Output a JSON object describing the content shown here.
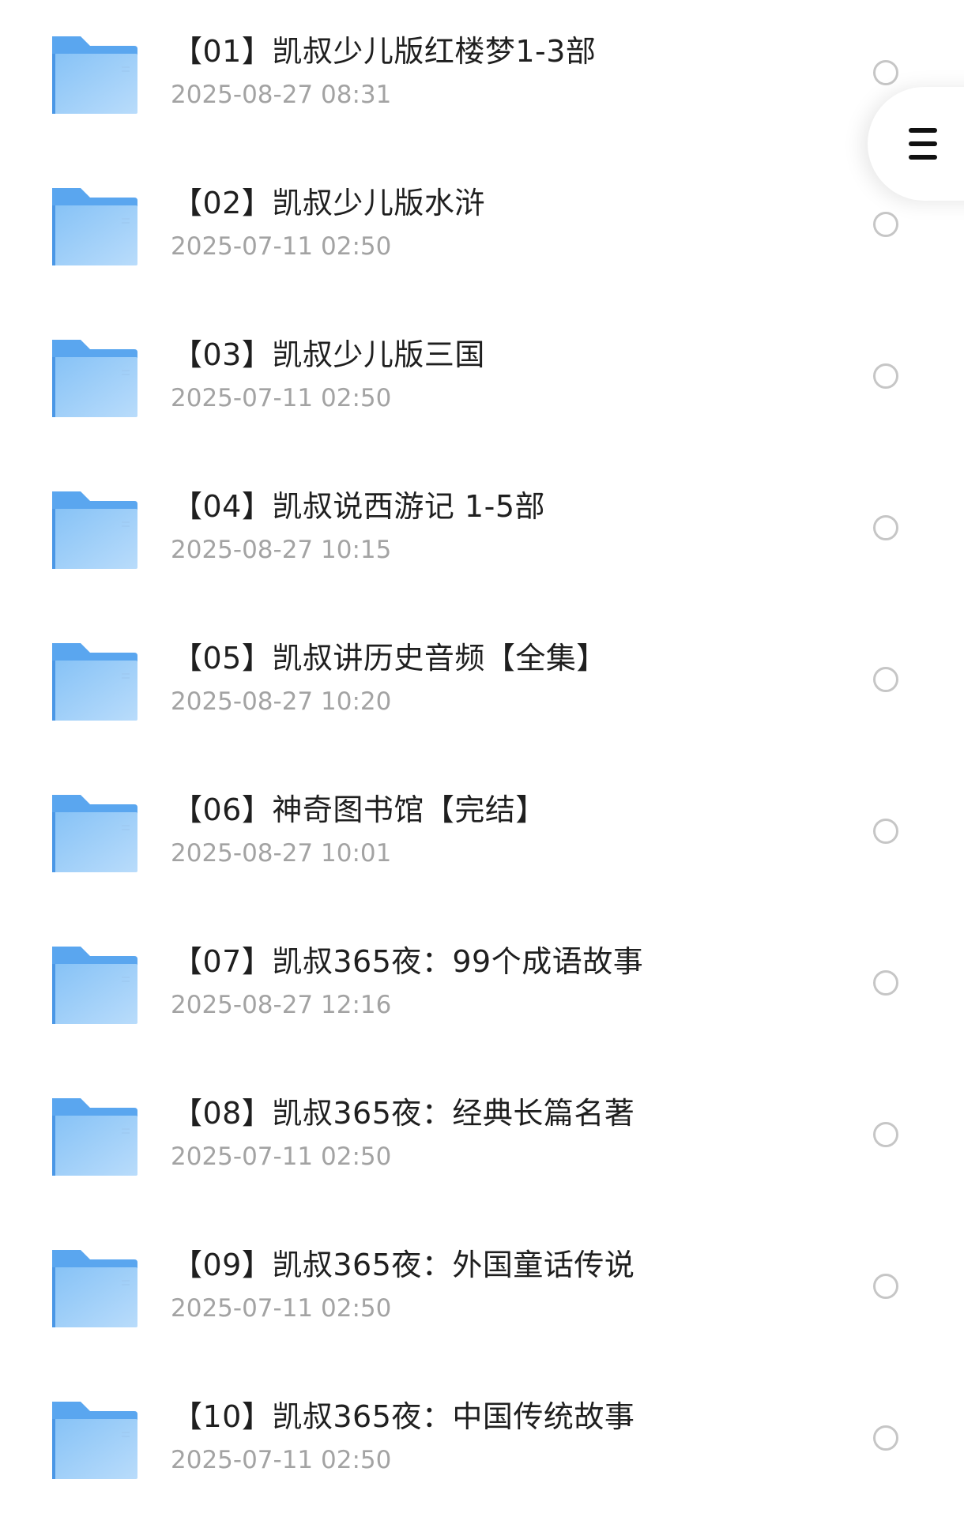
{
  "files": [
    {
      "name": "【01】凯叔少儿版红楼梦1-3部",
      "date": "2025-08-27 08:31"
    },
    {
      "name": "【02】凯叔少儿版水浒",
      "date": "2025-07-11 02:50"
    },
    {
      "name": "【03】凯叔少儿版三国",
      "date": "2025-07-11 02:50"
    },
    {
      "name": "【04】凯叔说西游记 1-5部",
      "date": "2025-08-27 10:15"
    },
    {
      "name": "【05】凯叔讲历史音频【全集】",
      "date": "2025-08-27 10:20"
    },
    {
      "name": "【06】神奇图书馆【完结】",
      "date": "2025-08-27 10:01"
    },
    {
      "name": "【07】凯叔365夜：99个成语故事",
      "date": "2025-08-27 12:16"
    },
    {
      "name": "【08】凯叔365夜：经典长篇名著",
      "date": "2025-07-11 02:50"
    },
    {
      "name": "【09】凯叔365夜：外国童话传说",
      "date": "2025-07-11 02:50"
    },
    {
      "name": "【10】凯叔365夜：中国传统故事",
      "date": "2025-07-11 02:50"
    }
  ],
  "icons": {
    "folder": "folder-icon",
    "menu": "menu-icon",
    "select": "radio-circle"
  },
  "colors": {
    "folder_light": "#b8dcfb",
    "folder_dark": "#5aa6ef",
    "title_text": "#1f1f1f",
    "date_text": "#a3a3a3",
    "radio_border": "#c6c6c6"
  }
}
